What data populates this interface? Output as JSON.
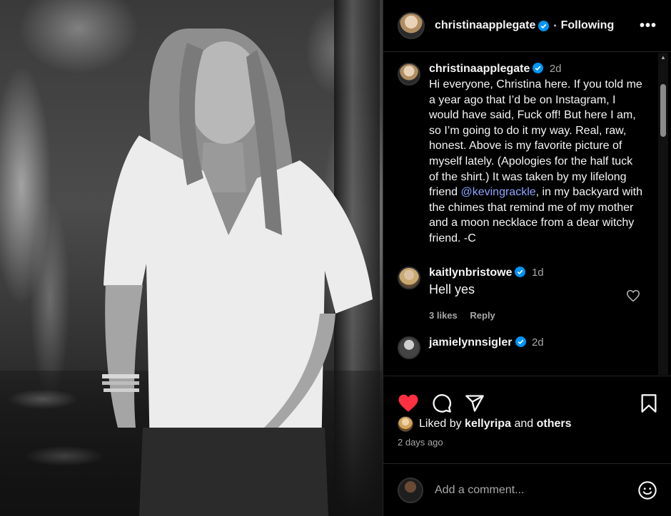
{
  "photo": {
    "icon": "post-photo"
  },
  "header": {
    "username": "christinaapplegate",
    "separator": "•",
    "follow_label": "Following",
    "more_label": "•••"
  },
  "caption": {
    "username": "christinaapplegate",
    "time": "2d",
    "text_before": "Hi everyone, Christina here. If you told me a year ago that I’d be on Instagram, I would have said, Fuck off! But here I am, so I’m going to do it my way. Real, raw, honest. Above is my favorite picture of myself lately. (Apologies for the half tuck of the shirt.) It was taken by my lifelong friend ",
    "mention": "@kevingrackle",
    "text_after": ", in my backyard with the chimes that remind me of my mother and a moon necklace from a dear witchy friend. -C"
  },
  "comments": [
    {
      "username": "kaitlynbristowe",
      "time": "1d",
      "text": "Hell yes",
      "likes": "3 likes",
      "reply_label": "Reply"
    },
    {
      "username": "jamielynnsigler",
      "time": "2d"
    }
  ],
  "likes": {
    "prefix": "Liked by",
    "user": "kellyripa",
    "conjunction": "and",
    "others": "others"
  },
  "timestamp": "2 days ago",
  "add_comment": {
    "placeholder": "Add a comment..."
  },
  "colors": {
    "like_red": "#ff3040",
    "verified_blue": "#0095f6",
    "mention": "#8fa3ff"
  }
}
